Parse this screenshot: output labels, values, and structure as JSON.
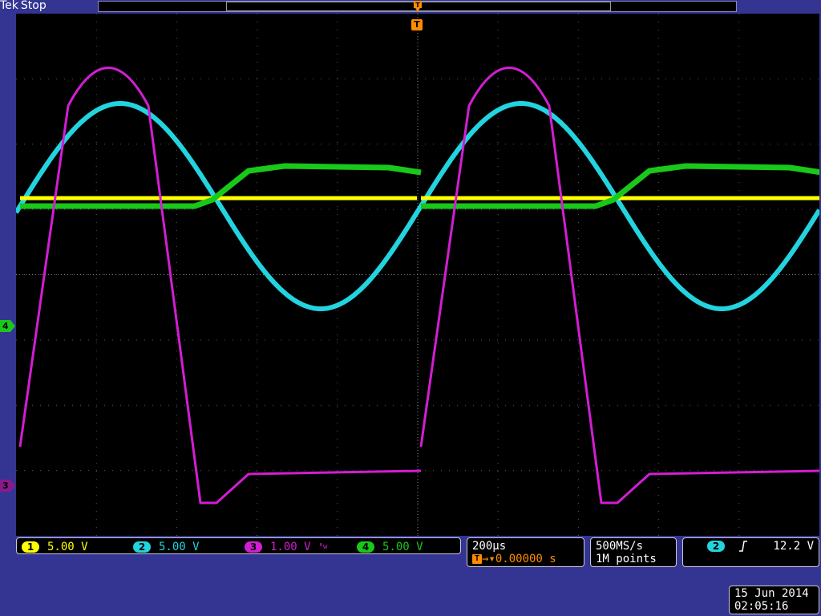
{
  "status": {
    "brand": "Tek",
    "acq_state": "Stop"
  },
  "trigger_marker": "T",
  "trigger_position_marker": "T",
  "channel_markers": [
    {
      "label": "4",
      "color": "#19c819"
    },
    {
      "label": "3",
      "color": "#d21ed2"
    }
  ],
  "channels": [
    {
      "num": "1",
      "scale": "5.00 V",
      "color": "#ffff00"
    },
    {
      "num": "2",
      "scale": "5.00 V",
      "color": "#22d4e0"
    },
    {
      "num": "3",
      "scale": "1.00 V",
      "color": "#d21ed2",
      "bw_icon": "ᴮw"
    },
    {
      "num": "4",
      "scale": "5.00 V",
      "color": "#19c819"
    }
  ],
  "timebase": {
    "scale": "200µs",
    "trigger_icon": "T",
    "delay": "→▾0.00000 s"
  },
  "acquisition": {
    "sample_rate": "500MS/s",
    "record_length": "1M points"
  },
  "trigger": {
    "source": "2",
    "slope_icon": "rising-edge-icon",
    "level": "12.2 V"
  },
  "datetime": {
    "date": "15 Jun 2014",
    "time": "02:05:16"
  },
  "colors": {
    "background": "#343592",
    "grid": "#5a5a5a",
    "ch1": "#ffff00",
    "ch2": "#22d4e0",
    "ch3": "#d21ed2",
    "ch4": "#19c819",
    "accent": "#ff8c00"
  }
}
